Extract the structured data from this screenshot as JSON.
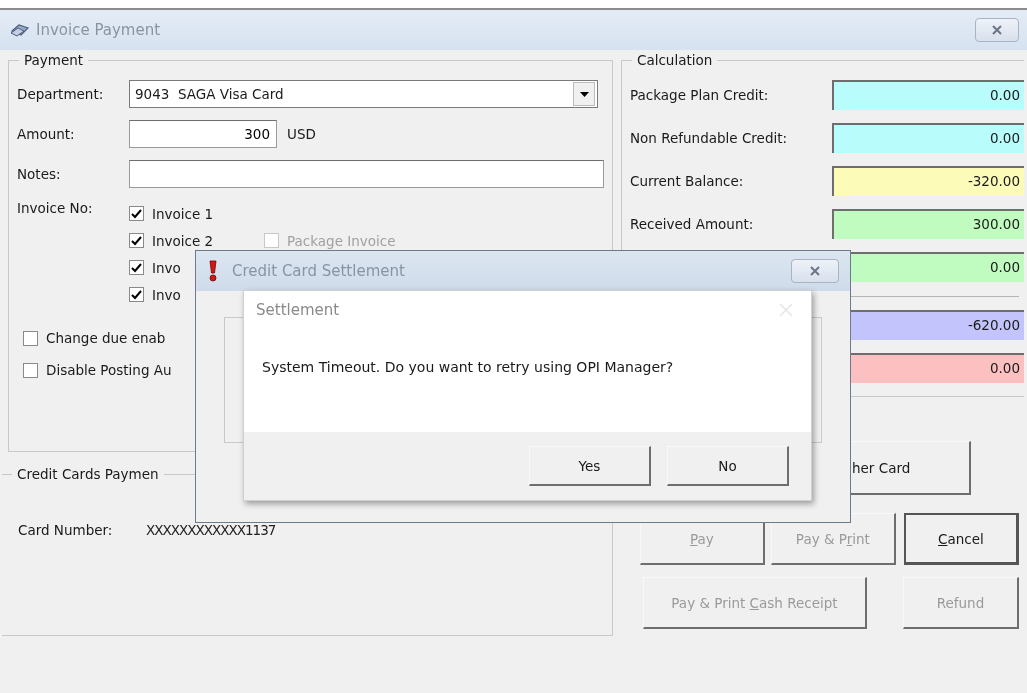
{
  "window": {
    "title": "Invoice Payment"
  },
  "payment": {
    "title": "Payment",
    "department": {
      "label": "Department:",
      "value": "9043  SAGA Visa Card"
    },
    "amount": {
      "label": "Amount:",
      "value": "300",
      "currency": "USD"
    },
    "notes": {
      "label": "Notes:"
    }
  },
  "invoices": {
    "label": "Invoice No:",
    "items": [
      {
        "label": "Invoice 1",
        "checked": true
      },
      {
        "label": "Invoice 2",
        "checked": true
      },
      {
        "label": "Invo",
        "checked": true
      },
      {
        "label": "Invo",
        "checked": true
      }
    ],
    "package_invoice": {
      "label": "Package Invoice",
      "checked": false,
      "disabled": true
    }
  },
  "options": [
    {
      "label": "Change due enab",
      "checked": false
    },
    {
      "label": "Disable Posting Au",
      "checked": false
    }
  ],
  "credit_cards": {
    "title": "Credit Cards Paymen",
    "card_number_label": "Card Number:",
    "card_number": "XXXXXXXXXXXX1137"
  },
  "calculation": {
    "title": "Calculation",
    "rows": [
      {
        "label": "Package Plan Credit:",
        "value": "0.00",
        "color": "#b8fcfc",
        "divider_before": false
      },
      {
        "label": "Non Refundable Credit:",
        "value": "0.00",
        "color": "#b8fcfc",
        "divider_before": false
      },
      {
        "label": "Current Balance:",
        "value": "-320.00",
        "color": "#fcfcb8",
        "divider_before": false
      },
      {
        "label": "Received Amount:",
        "value": "300.00",
        "color": "#c0fcc0",
        "divider_before": false
      },
      {
        "value": "0.00",
        "color": "#c0fcc0",
        "divider_before": false
      },
      {
        "value": "-620.00",
        "color": "#c4c4fc",
        "divider_before": true
      },
      {
        "value": "0.00",
        "color": "#fcc0c0",
        "divider_before": false
      }
    ]
  },
  "card_button": {
    "label": "her Card"
  },
  "action_buttons": [
    [
      {
        "label_parts": [
          {
            "text": "P",
            "underlined": true
          },
          {
            "text": "ay",
            "underlined": false
          }
        ],
        "disabled": true,
        "focused": false
      },
      {
        "label_parts": [
          {
            "text": "Pay & P",
            "underlined": false
          },
          {
            "text": "r",
            "underlined": true
          },
          {
            "text": "int",
            "underlined": false
          }
        ],
        "disabled": true,
        "focused": false
      },
      {
        "label_parts": [
          {
            "text": "C",
            "underlined": true
          },
          {
            "text": "ancel",
            "underlined": false
          }
        ],
        "disabled": false,
        "focused": true
      }
    ],
    [
      {
        "label_parts": [
          {
            "text": "Pay & Print ",
            "underlined": false
          },
          {
            "text": "C",
            "underlined": true
          },
          {
            "text": "ash Receipt",
            "underlined": false
          }
        ],
        "disabled": true,
        "focused": false
      },
      {
        "label_parts": [
          {
            "text": "Refund",
            "underlined": false
          }
        ],
        "disabled": true,
        "focused": false
      }
    ]
  ],
  "dialog": {
    "title": "Credit Card Settlement"
  },
  "message_box": {
    "title": "Settlement",
    "message": "System Timeout. Do you want to retry using OPI Manager?",
    "buttons": [
      {
        "label": "Yes"
      },
      {
        "label": "No"
      }
    ]
  }
}
